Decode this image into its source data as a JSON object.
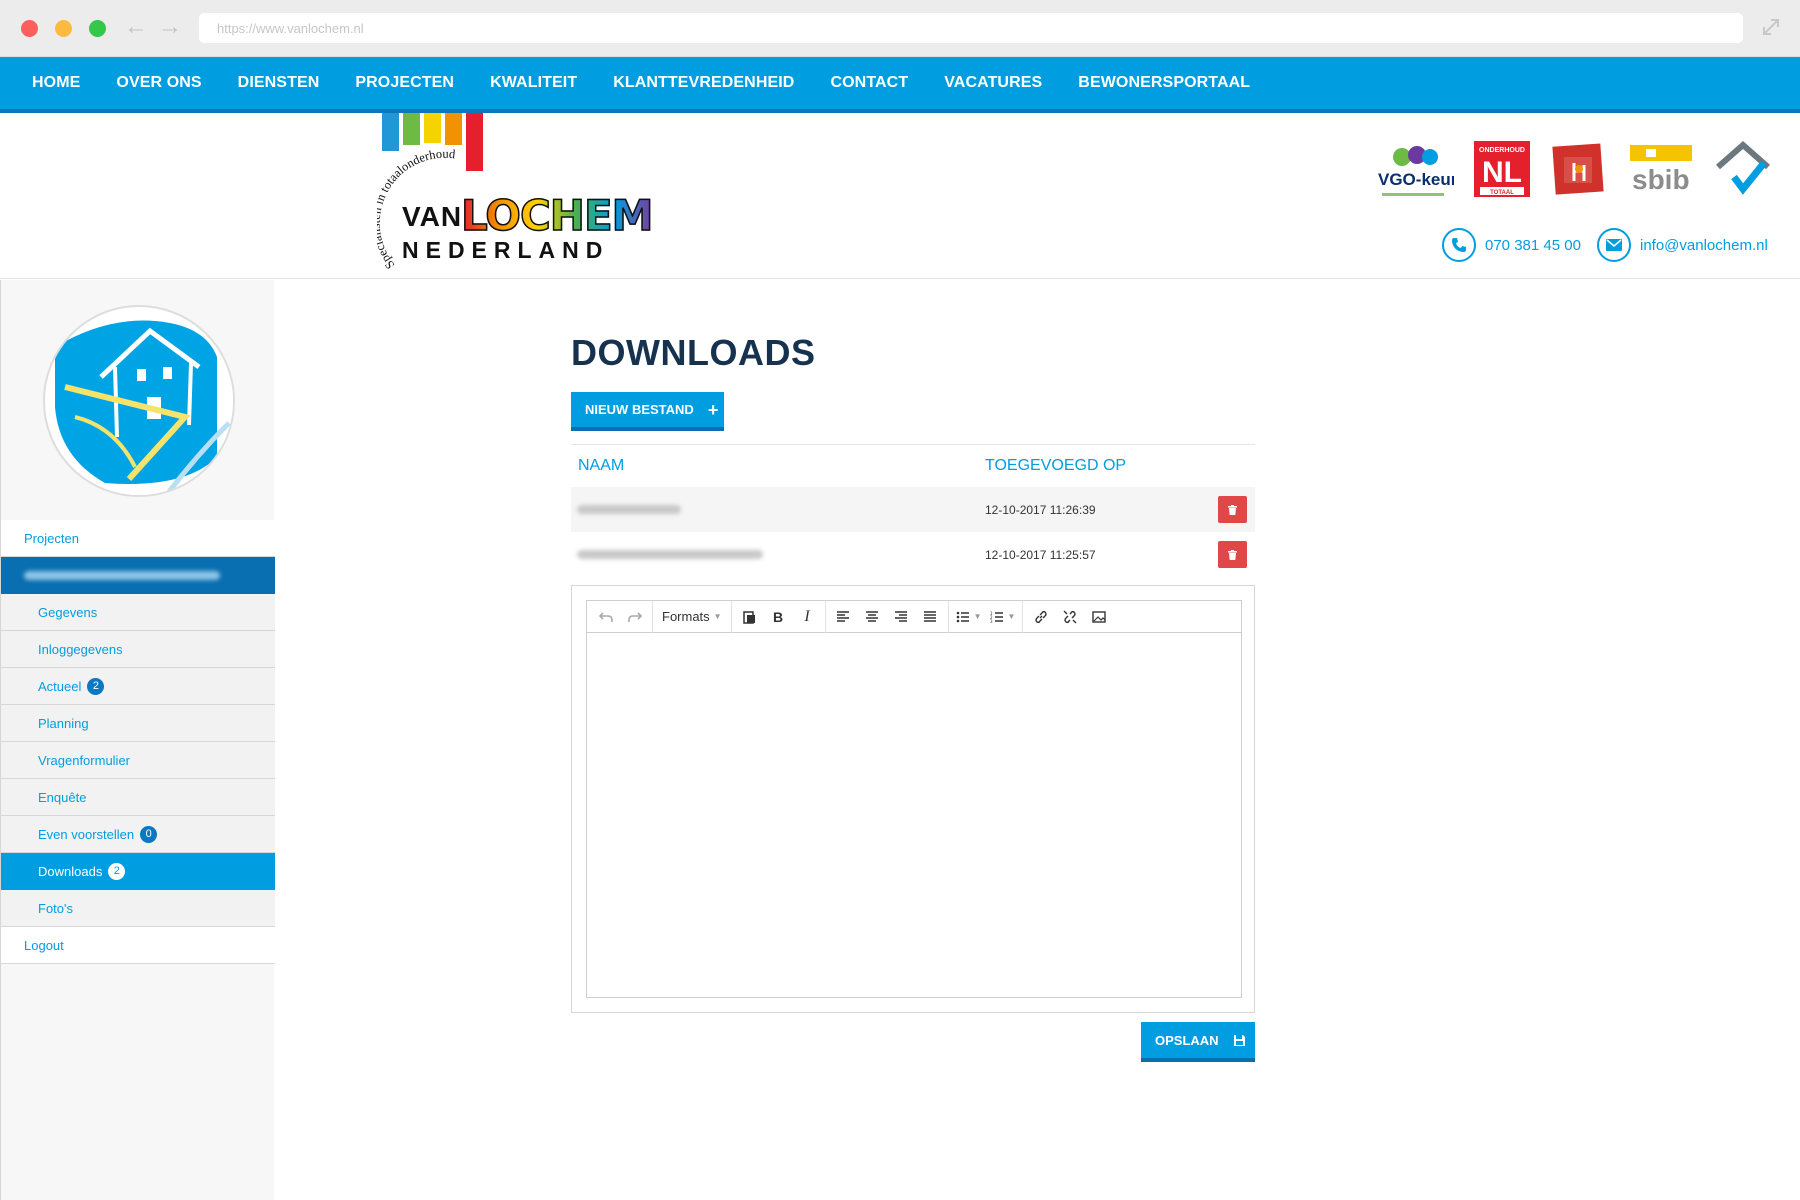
{
  "browser": {
    "url": "https://www.vanlochem.nl"
  },
  "topnav": {
    "items": [
      "HOME",
      "OVER ONS",
      "DIENSTEN",
      "PROJECTEN",
      "KWALITEIT",
      "KLANTTEVREDENHEID",
      "CONTACT",
      "VACATURES",
      "BEWONERSPORTAAL"
    ]
  },
  "header": {
    "logo": {
      "arc_text": "Specialisten in totaalonderhoud",
      "van": "VAN",
      "lochem": "LOCHEM",
      "nederland": "NEDERLAND",
      "stripe_colors": [
        "#2196d8",
        "#6dbb45",
        "#f5d300",
        "#f39200",
        "#e4202c"
      ]
    },
    "badges": {
      "vgo": "VGO-keur",
      "onderhoud_top": "ONDERHOUD",
      "onderhoud_nl": "NL",
      "onderhoud_bottom": "TOTAAL",
      "sbib": "sbib"
    },
    "phone": "070 381 45 00",
    "email": "info@vanlochem.nl"
  },
  "sidebar": {
    "top_item": "Projecten",
    "sub_items": [
      {
        "label": "Gegevens",
        "count": null,
        "active": false
      },
      {
        "label": "Inloggegevens",
        "count": null,
        "active": false
      },
      {
        "label": "Actueel",
        "count": "2",
        "active": false
      },
      {
        "label": "Planning",
        "count": null,
        "active": false
      },
      {
        "label": "Vragenformulier",
        "count": null,
        "active": false
      },
      {
        "label": "Enquête",
        "count": null,
        "active": false
      },
      {
        "label": "Even voorstellen",
        "count": "0",
        "active": false
      },
      {
        "label": "Downloads",
        "count": "2",
        "active": true
      },
      {
        "label": "Foto's",
        "count": null,
        "active": false
      }
    ],
    "logout": "Logout"
  },
  "main": {
    "title": "DOWNLOADS",
    "new_button": "NIEUW BESTAND",
    "table": {
      "headers": [
        "NAAM",
        "TOEGEVOEGD OP"
      ],
      "rows": [
        {
          "date": "12-10-2017 11:26:39"
        },
        {
          "date": "12-10-2017 11:25:57"
        }
      ]
    },
    "editor": {
      "formats_label": "Formats"
    },
    "save_button": "OPSLAAN"
  },
  "colors": {
    "primary": "#009ee0",
    "primary_dark": "#0a6fb0",
    "title": "#16324f",
    "danger": "#e04848"
  }
}
